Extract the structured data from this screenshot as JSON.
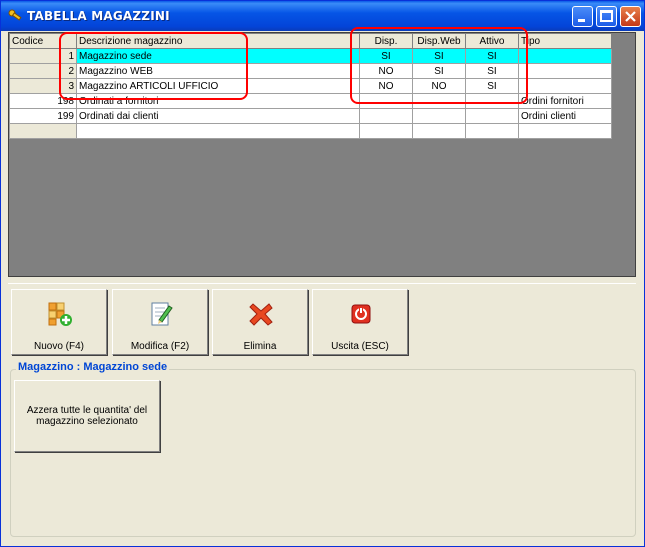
{
  "window": {
    "title": "TABELLA MAGAZZINI"
  },
  "grid": {
    "headers": [
      "Codice",
      "Descrizione magazzino",
      "Disp.",
      "Disp.Web",
      "Attivo",
      "Tipo"
    ],
    "rows": [
      [
        "1",
        "Magazzino sede",
        "SI",
        "SI",
        "SI",
        ""
      ],
      [
        "2",
        "Magazzino WEB",
        "NO",
        "SI",
        "SI",
        ""
      ],
      [
        "3",
        "Magazzino ARTICOLI UFFICIO",
        "NO",
        "NO",
        "SI",
        ""
      ],
      [
        "198",
        "Ordinati a fornitori",
        "",
        "",
        "",
        "Ordini fornitori"
      ],
      [
        "199",
        "Ordinati dai clienti",
        "",
        "",
        "",
        "Ordini clienti"
      ],
      [
        "",
        "",
        "",
        "",
        "",
        ""
      ]
    ],
    "selected_row": 0
  },
  "toolbar": {
    "new_label": "Nuovo (F4)",
    "edit_label": "Modifica (F2)",
    "delete_label": "Elimina",
    "exit_label": "Uscita (ESC)"
  },
  "group": {
    "title": "Magazzino : Magazzino sede",
    "reset_label": "Azzera tutte le quantita' del magazzino selezionato"
  },
  "colors": {
    "selection": "#00ffff",
    "highlight_box": "#ff0000",
    "group_title": "#0046d5"
  }
}
